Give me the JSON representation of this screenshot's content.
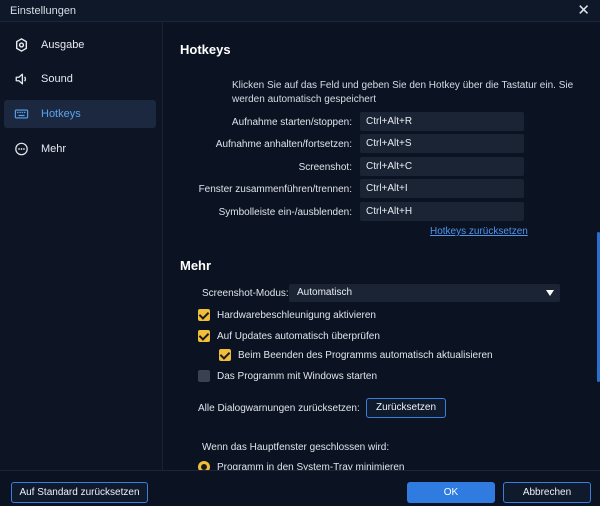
{
  "window": {
    "title": "Einstellungen",
    "close_glyph": "✕"
  },
  "sidebar": {
    "items": [
      {
        "label": "Ausgabe",
        "icon": "gear-icon"
      },
      {
        "label": "Sound",
        "icon": "speaker-icon"
      },
      {
        "label": "Hotkeys",
        "icon": "keyboard-icon",
        "active": true
      },
      {
        "label": "Mehr",
        "icon": "more-icon"
      }
    ]
  },
  "hotkeys": {
    "heading": "Hotkeys",
    "description": "Klicken Sie auf das Feld und geben Sie den Hotkey über die Tastatur ein. Sie werden automatisch gespeichert",
    "rows": [
      {
        "label": "Aufnahme starten/stoppen:",
        "value": "Ctrl+Alt+R"
      },
      {
        "label": "Aufnahme anhalten/fortsetzen:",
        "value": "Ctrl+Alt+S"
      },
      {
        "label": "Screenshot:",
        "value": "Ctrl+Alt+C"
      },
      {
        "label": "Fenster zusammenführen/trennen:",
        "value": "Ctrl+Alt+I"
      },
      {
        "label": "Symbolleiste ein-/ausblenden:",
        "value": "Ctrl+Alt+H"
      }
    ],
    "reset_link": "Hotkeys zurücksetzen"
  },
  "mehr": {
    "heading": "Mehr",
    "screenshot_mode_label": "Screenshot-Modus:",
    "screenshot_mode_value": "Automatisch",
    "checkboxes": [
      {
        "label": "Hardwarebeschleunigung aktivieren",
        "checked": true
      },
      {
        "label": "Auf Updates automatisch überprüfen",
        "checked": true
      },
      {
        "label": "Beim Beenden des Programms automatisch aktualisieren",
        "checked": true
      },
      {
        "label": "Das Programm mit Windows starten",
        "checked": false
      }
    ],
    "dialog_reset_label": "Alle Dialogwarnungen zurücksetzen:",
    "dialog_reset_button": "Zurücksetzen",
    "close_label": "Wenn das Hauptfenster geschlossen wird:",
    "radio_option": "Programm in den System-Tray minimieren"
  },
  "footer": {
    "reset_defaults": "Auf Standard zurücksetzen",
    "ok": "OK",
    "cancel": "Abbrechen"
  },
  "colors": {
    "accent": "#2f7be0",
    "checkbox": "#f1be3a",
    "active_nav_text": "#5aa2f0",
    "background": "#0b1322"
  }
}
